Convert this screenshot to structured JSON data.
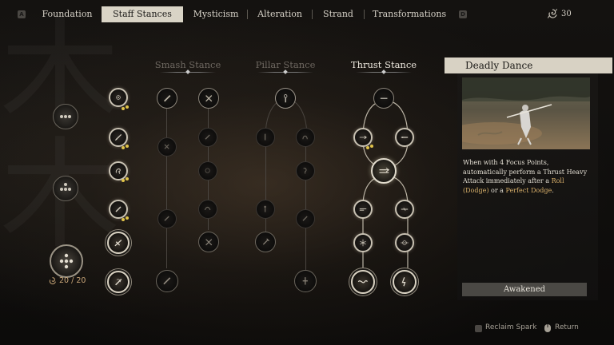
{
  "nav": {
    "left_key": "A",
    "right_key": "D",
    "tabs": [
      {
        "label": "Foundation",
        "active": false
      },
      {
        "label": "Staff Stances",
        "active": true
      },
      {
        "label": "Mysticism",
        "active": false
      },
      {
        "label": "Alteration",
        "active": false
      },
      {
        "label": "Strand",
        "active": false
      },
      {
        "label": "Transformations",
        "active": false
      }
    ],
    "spark_count": "30"
  },
  "columns": {
    "smash": "Smash Stance",
    "pillar": "Pillar Stance",
    "thrust": "Thrust Stance"
  },
  "left_panel": {
    "focus_label": "20 / 20"
  },
  "detail": {
    "title": "Deadly Dance",
    "desc_1": "When with 4 Focus Points, automatically perform a Thrust Heavy Attack immediately after a ",
    "desc_hl_1": "Roll (Dodge)",
    "desc_2": " or a ",
    "desc_hl_2": "Perfect Dodge",
    "desc_3": ".",
    "status": "Awakened"
  },
  "footer": {
    "reclaim": "Reclaim Spark",
    "return": "Return"
  },
  "colors": {
    "accent_gold": "#e0c34a",
    "highlight_text": "#d8b06a",
    "active_tab_bg": "#d9d4c6"
  },
  "icons": [
    "spark-icon",
    "staff-icon",
    "mouse-icon",
    "pillar-icon",
    "thrust-icon"
  ]
}
